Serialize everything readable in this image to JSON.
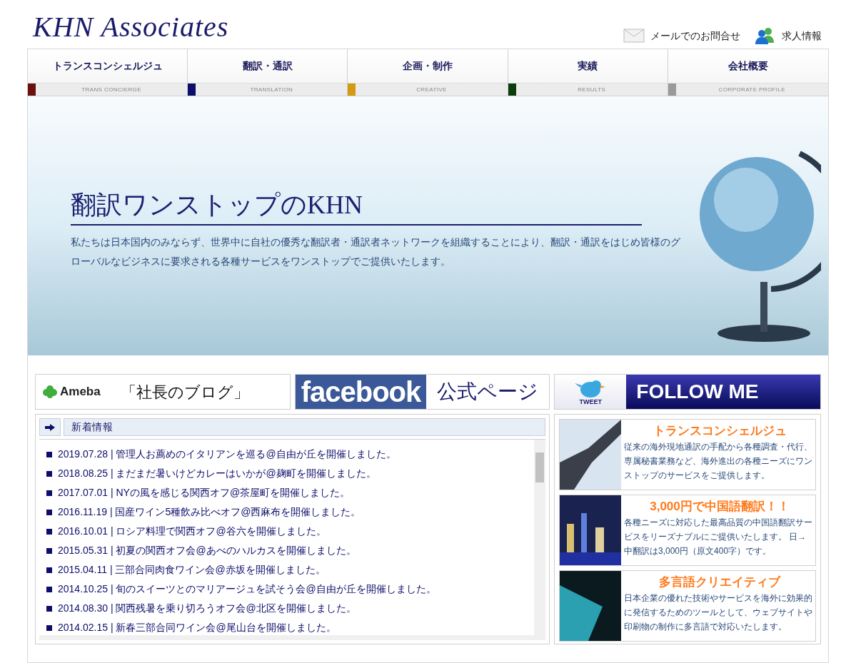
{
  "header": {
    "logo": "KHN Associates",
    "links": [
      {
        "kind": "mail",
        "label": "メールでのお問合せ"
      },
      {
        "kind": "people",
        "label": "求人情報"
      }
    ]
  },
  "nav": [
    {
      "label": "トランスコンシェルジュ",
      "sublabel": "TRANS CONCIERGE",
      "color": "#6b0f0f"
    },
    {
      "label": "翻訳・通訳",
      "sublabel": "TRANSLATION",
      "color": "#0d0d6b"
    },
    {
      "label": "企画・制作",
      "sublabel": "CREATIVE",
      "color": "#d49a10"
    },
    {
      "label": "実績",
      "sublabel": "RESULTS",
      "color": "#0d3d0d"
    },
    {
      "label": "会社概要",
      "sublabel": "CORPORATE PROFILE",
      "color": "#9a9a9a"
    }
  ],
  "hero": {
    "title": "翻訳ワンストップのKHN",
    "description": "私たちは日本国内のみならず、世界中に自社の優秀な翻訳者・通訳者ネットワークを組織することにより、翻訳・通訳をはじめ皆様のグローバルなビジネスに要求される各種サービスをワンストップでご提供いたします。"
  },
  "banners": [
    {
      "kind": "ameba",
      "brand": "Ameba",
      "label": "「社長のブログ」"
    },
    {
      "kind": "facebook",
      "brand": "facebook",
      "label": "公式ページ"
    },
    {
      "kind": "twitter",
      "brand": "TWEET",
      "label": "FOLLOW ME"
    }
  ],
  "news": {
    "title": "新着情報",
    "items": [
      "2019.07.28 | 管理人お薦めのイタリアンを巡る@自由が丘を開催しました。",
      "2018.08.25 | まだまだ暑いけどカレーはいかが@麹町を開催しました。",
      "2017.07.01 | NYの風を感じる関西オフ@茶屋町を開催しました。",
      "2016.11.19 | 国産ワイン5種飲み比べオフ@西麻布を開催しました。",
      "2016.10.01 | ロシア料理で関西オフ@谷六を開催しました。",
      "2015.05.31 | 初夏の関西オフ会@あべのハルカスを開催しました。",
      "2015.04.11 | 三部合同肉食ワイン会@赤坂を開催しました。",
      "2014.10.25 | 旬のスイーツとのマリアージュを試そう会@自由が丘を開催しました。",
      "2014.08.30 | 関西残暑を乗り切ろうオフ会@北区を開催しました。",
      "2014.02.15 | 新春三部合同ワイン会@尾山台を開催しました。"
    ]
  },
  "services": [
    {
      "kind": "handshake",
      "title": "トランスコンシェルジュ",
      "text": "従来の海外現地通訳の手配から各種調査・代行、専属秘書業務など、海外進出の各種ニーズにワンストップのサービスをご提供します。"
    },
    {
      "kind": "city",
      "title": "3,000円で中国語翻訳！！",
      "text": "各種ニーズに対応した最高品質の中国語翻訳サービスをリーズナブルにご提供いたします。 日→中翻訳は3,000円（原文400字）です。"
    },
    {
      "kind": "laptop",
      "title": "多言語クリエイティブ",
      "text": "日本企業の優れた技術やサービスを海外に効果的に発信するためのツールとして、ウェブサイトや印刷物の制作に多言語で対応いたします。"
    }
  ]
}
